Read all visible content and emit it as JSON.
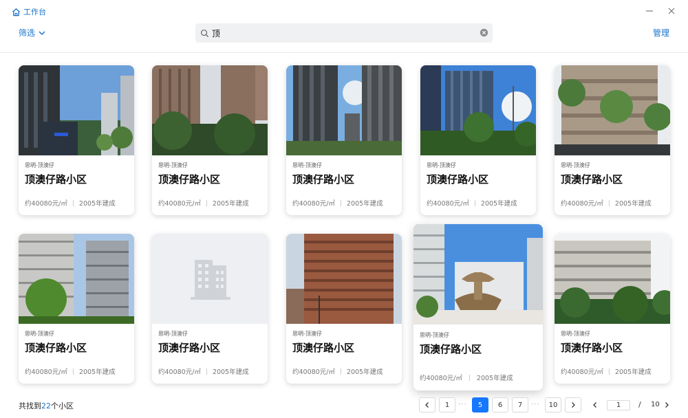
{
  "window": {
    "title": "工作台"
  },
  "toolbar": {
    "filter_label": "筛选",
    "search_value": "顶",
    "manage_label": "管理"
  },
  "cards": [
    {
      "district": "思明-顶澳仔",
      "name": "顶澳仔路小区",
      "price": "约40080元/㎡",
      "year": "2005年建成"
    },
    {
      "district": "思明-顶澳仔",
      "name": "顶澳仔路小区",
      "price": "约40080元/㎡",
      "year": "2005年建成"
    },
    {
      "district": "思明-顶澳仔",
      "name": "顶澳仔路小区",
      "price": "约40080元/㎡",
      "year": "2005年建成"
    },
    {
      "district": "思明-顶澳仔",
      "name": "顶澳仔路小区",
      "price": "约40080元/㎡",
      "year": "2005年建成"
    },
    {
      "district": "思明-顶澳仔",
      "name": "顶澳仔路小区",
      "price": "约40080元/㎡",
      "year": "2005年建成"
    },
    {
      "district": "思明-顶澳仔",
      "name": "顶澳仔路小区",
      "price": "约40080元/㎡",
      "year": "2005年建成"
    },
    {
      "district": "思明-顶澳仔",
      "name": "顶澳仔路小区",
      "price": "约40080元/㎡",
      "year": "2005年建成"
    },
    {
      "district": "思明-顶澳仔",
      "name": "顶澳仔路小区",
      "price": "约40080元/㎡",
      "year": "2005年建成"
    },
    {
      "district": "思明-顶澳仔",
      "name": "顶澳仔路小区",
      "price": "约40080元/㎡",
      "year": "2005年建成"
    },
    {
      "district": "思明-顶澳仔",
      "name": "顶澳仔路小区",
      "price": "约40080元/㎡",
      "year": "2005年建成"
    }
  ],
  "footer": {
    "count_prefix": "共找到",
    "count": "22",
    "count_suffix": "个小区"
  },
  "pagination": {
    "pages": [
      "1",
      "5",
      "6",
      "7",
      "10"
    ],
    "active": "5",
    "dots": "···",
    "jump_value": "1",
    "slash": "/",
    "total_pages": "10"
  },
  "colors": {
    "accent": "#1a73c9",
    "active_page": "#1677ff",
    "placeholder_bg": "#eeeff2"
  },
  "icons": {
    "home": "home-icon",
    "minimize": "minimize-icon",
    "close": "close-icon",
    "filter_chevron": "chevron-down-icon",
    "search": "search-icon",
    "clear": "clear-icon",
    "placeholder": "building-icon",
    "prev": "chevron-left-icon",
    "next": "chevron-right-icon"
  }
}
